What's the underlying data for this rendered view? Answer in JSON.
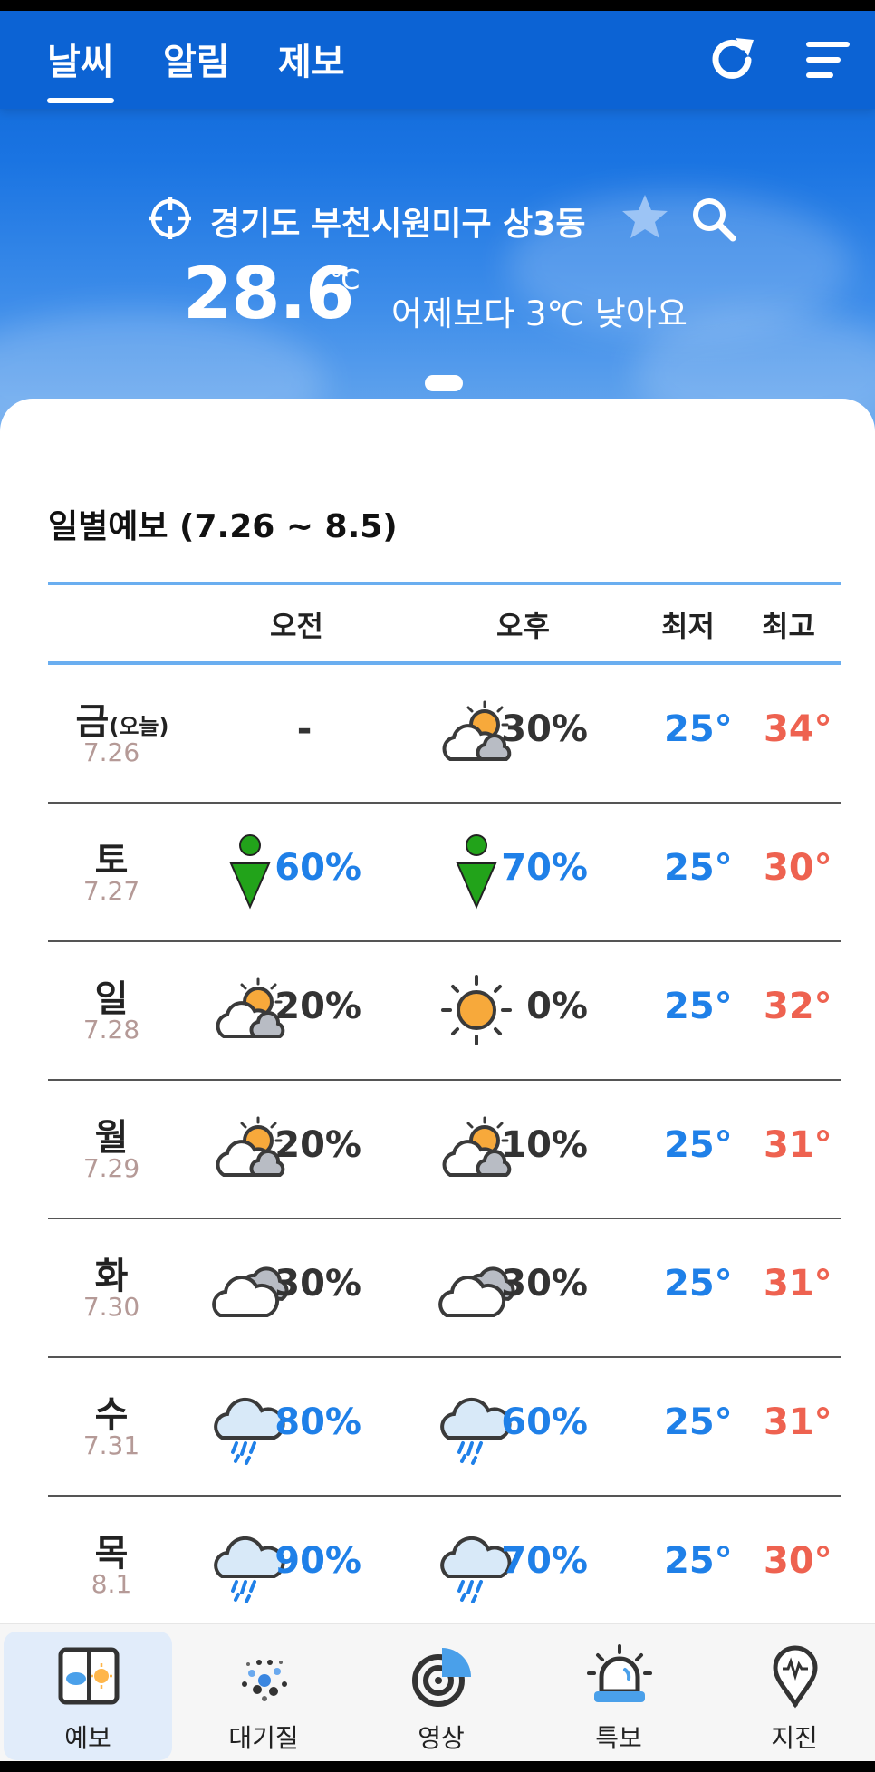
{
  "nav": {
    "tabs": [
      {
        "label": "날씨",
        "active": true
      },
      {
        "label": "알림",
        "active": false
      },
      {
        "label": "제보",
        "active": false
      }
    ],
    "refresh_icon": "refresh-icon",
    "menu_icon": "menu-icon"
  },
  "location": {
    "name": "경기도 부천시원미구 상3동",
    "target_icon": "crosshair-icon",
    "favorite_icon": "star-icon",
    "search_icon": "search-icon"
  },
  "current": {
    "temperature": "28.6",
    "unit": "℃",
    "compare": "어제보다 3℃ 낮아요"
  },
  "forecast": {
    "title": "일별예보 (7.26 ~ 8.5)",
    "headers": {
      "am": "오전",
      "pm": "오후",
      "min": "최저",
      "max": "최고"
    },
    "colors": {
      "rain_blue": "#1f80e8",
      "dark": "#333333",
      "max_red": "#ee6250",
      "date": "#b59a97"
    },
    "rows": [
      {
        "day": "금",
        "sub": "(오늘)",
        "date": "7.26",
        "am_icon": "",
        "am_pct": "-",
        "am_blue": false,
        "pm_icon": "partly-cloudy-icon",
        "pm_pct": "30%",
        "pm_blue": false,
        "min": "25°",
        "max": "34°"
      },
      {
        "day": "토",
        "sub": "",
        "date": "7.27",
        "am_icon": "green-pin-icon",
        "am_pct": "60%",
        "am_blue": true,
        "pm_icon": "green-pin-icon",
        "pm_pct": "70%",
        "pm_blue": true,
        "min": "25°",
        "max": "30°"
      },
      {
        "day": "일",
        "sub": "",
        "date": "7.28",
        "am_icon": "partly-cloudy-icon",
        "am_pct": "20%",
        "am_blue": false,
        "pm_icon": "sun-icon",
        "pm_pct": "0%",
        "pm_blue": false,
        "min": "25°",
        "max": "32°"
      },
      {
        "day": "월",
        "sub": "",
        "date": "7.29",
        "am_icon": "partly-cloudy-icon",
        "am_pct": "20%",
        "am_blue": false,
        "pm_icon": "partly-cloudy-icon",
        "pm_pct": "10%",
        "pm_blue": false,
        "min": "25°",
        "max": "31°"
      },
      {
        "day": "화",
        "sub": "",
        "date": "7.30",
        "am_icon": "cloudy-icon",
        "am_pct": "30%",
        "am_blue": false,
        "pm_icon": "cloudy-icon",
        "pm_pct": "30%",
        "pm_blue": false,
        "min": "25°",
        "max": "31°"
      },
      {
        "day": "수",
        "sub": "",
        "date": "7.31",
        "am_icon": "rain-icon",
        "am_pct": "80%",
        "am_blue": true,
        "pm_icon": "rain-icon",
        "pm_pct": "60%",
        "pm_blue": true,
        "min": "25°",
        "max": "31°"
      },
      {
        "day": "목",
        "sub": "",
        "date": "8.1",
        "am_icon": "rain-icon",
        "am_pct": "90%",
        "am_blue": true,
        "pm_icon": "rain-icon",
        "pm_pct": "70%",
        "pm_blue": true,
        "min": "25°",
        "max": "30°"
      }
    ]
  },
  "bottom_nav": [
    {
      "label": "예보",
      "icon": "forecast-icon",
      "active": true
    },
    {
      "label": "대기질",
      "icon": "air-quality-icon",
      "active": false
    },
    {
      "label": "영상",
      "icon": "radar-icon",
      "active": false
    },
    {
      "label": "특보",
      "icon": "alert-siren-icon",
      "active": false
    },
    {
      "label": "지진",
      "icon": "earthquake-pin-icon",
      "active": false
    }
  ]
}
